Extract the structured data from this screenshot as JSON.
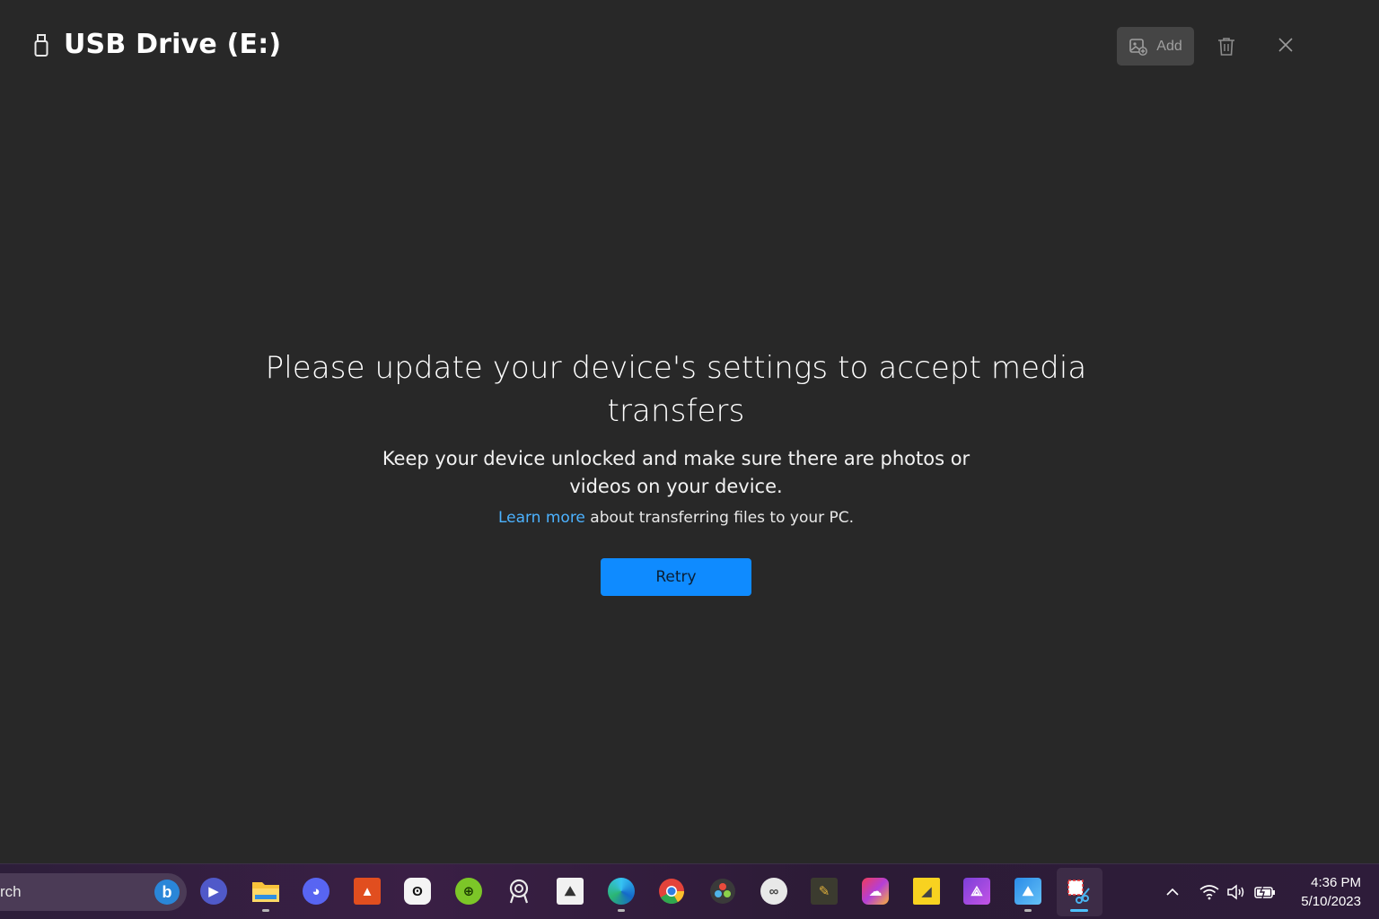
{
  "window": {
    "title": "USB Drive (E:)",
    "add_label": "Add"
  },
  "message": {
    "headline": "Please update your device's settings to accept media transfers",
    "subtext": "Keep your device unlocked and make sure there are photos or videos on your device.",
    "learn_link": "Learn more",
    "learn_rest": " about transferring files to your PC."
  },
  "retry_label": "Retry",
  "taskbar": {
    "search_text": "rch",
    "apps": [
      "bing-icon",
      "meet-icon",
      "file-explorer-icon",
      "discord-icon",
      "sketchbook-icon",
      "lasso-icon",
      "android-icon",
      "ribbon-icon",
      "gimp-icon",
      "edge-icon",
      "chrome-icon",
      "davinci-resolve-icon",
      "cloud-icon",
      "vector-icon",
      "creative-cloud-icon",
      "sticky-notes-icon",
      "affinity-photo-icon",
      "photos-icon",
      "snipping-tool-icon"
    ],
    "time": "4:36 PM",
    "date": "5/10/2023"
  },
  "colors": {
    "background": "#282828",
    "accent": "#0f8bff",
    "link": "#4cb2ff"
  }
}
